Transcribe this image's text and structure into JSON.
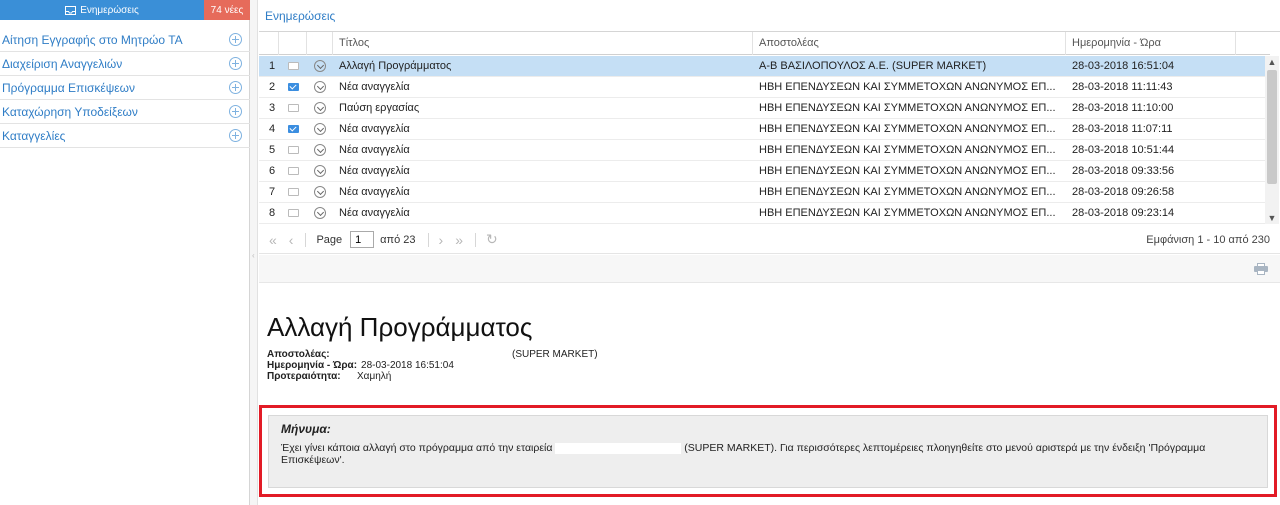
{
  "sidebar": {
    "title": "Ενημερώσεις",
    "badge": "74 νέες",
    "items": [
      {
        "label": "Αίτηση Εγγραφής στο Μητρώο ΤΑ"
      },
      {
        "label": "Διαχείριση Αναγγελιών"
      },
      {
        "label": "Πρόγραμμα Επισκέψεων"
      },
      {
        "label": "Καταχώρηση Υποδείξεων"
      },
      {
        "label": "Καταγγελίες"
      }
    ]
  },
  "panel": {
    "title": "Ενημερώσεις"
  },
  "grid": {
    "columns": {
      "title": "Τίτλος",
      "sender": "Αποστολέας",
      "date": "Ημερομηνία - Ώρα"
    },
    "rows": [
      {
        "num": "1",
        "read": true,
        "title": "Αλλαγή Προγράμματος",
        "sender": "Α-Β ΒΑΣΙΛΟΠΟΥΛΟΣ Α.Ε. (SUPER MARKET)",
        "date": "28-03-2018 16:51:04",
        "selected": true
      },
      {
        "num": "2",
        "read": false,
        "title": "Νέα αναγγελία",
        "sender": "ΗΒΗ ΕΠΕΝΔΥΣΕΩΝ ΚΑΙ ΣΥΜΜΕΤΟΧΩΝ ΑΝΩΝΥΜΟΣ ΕΠ...",
        "date": "28-03-2018 11:11:43",
        "selected": false
      },
      {
        "num": "3",
        "read": true,
        "title": "Παύση εργασίας",
        "sender": "ΗΒΗ ΕΠΕΝΔΥΣΕΩΝ ΚΑΙ ΣΥΜΜΕΤΟΧΩΝ ΑΝΩΝΥΜΟΣ ΕΠ...",
        "date": "28-03-2018 11:10:00",
        "selected": false
      },
      {
        "num": "4",
        "read": false,
        "title": "Νέα αναγγελία",
        "sender": "ΗΒΗ ΕΠΕΝΔΥΣΕΩΝ ΚΑΙ ΣΥΜΜΕΤΟΧΩΝ ΑΝΩΝΥΜΟΣ ΕΠ...",
        "date": "28-03-2018 11:07:11",
        "selected": false
      },
      {
        "num": "5",
        "read": true,
        "title": "Νέα αναγγελία",
        "sender": "ΗΒΗ ΕΠΕΝΔΥΣΕΩΝ ΚΑΙ ΣΥΜΜΕΤΟΧΩΝ ΑΝΩΝΥΜΟΣ ΕΠ...",
        "date": "28-03-2018 10:51:44",
        "selected": false
      },
      {
        "num": "6",
        "read": true,
        "title": "Νέα αναγγελία",
        "sender": "ΗΒΗ ΕΠΕΝΔΥΣΕΩΝ ΚΑΙ ΣΥΜΜΕΤΟΧΩΝ ΑΝΩΝΥΜΟΣ ΕΠ...",
        "date": "28-03-2018 09:33:56",
        "selected": false
      },
      {
        "num": "7",
        "read": true,
        "title": "Νέα αναγγελία",
        "sender": "ΗΒΗ ΕΠΕΝΔΥΣΕΩΝ ΚΑΙ ΣΥΜΜΕΤΟΧΩΝ ΑΝΩΝΥΜΟΣ ΕΠ...",
        "date": "28-03-2018 09:26:58",
        "selected": false
      },
      {
        "num": "8",
        "read": true,
        "title": "Νέα αναγγελία",
        "sender": "ΗΒΗ ΕΠΕΝΔΥΣΕΩΝ ΚΑΙ ΣΥΜΜΕΤΟΧΩΝ ΑΝΩΝΥΜΟΣ ΕΠ...",
        "date": "28-03-2018 09:23:14",
        "selected": false
      }
    ]
  },
  "pager": {
    "page_label": "Page",
    "page_value": "1",
    "of_label": "από 23",
    "info": "Εμφάνιση 1 - 10 από 230"
  },
  "detail": {
    "title": "Αλλαγή Προγράμματος",
    "sender_label": "Αποστολέας:",
    "sender_value": "(SUPER MARKET)",
    "date_label": "Ημερομηνία - Ώρα:",
    "date_value": "28-03-2018 16:51:04",
    "priority_label": "Προτεραιότητα:",
    "priority_value": "Χαμηλή",
    "message_label": "Μήνυμα:",
    "message_before": "Έχει γίνει κάποια αλλαγή στο πρόγραμμα από την εταιρεία",
    "message_after": "(SUPER MARKET). Για περισσότερες λεπτομέρειες πλοηγηθείτε στο μενού αριστερά με την ένδειξη 'Πρόγραμμα Επισκέψεων'."
  },
  "colors": {
    "accent": "#3a8fd7",
    "badge": "#e66b5b",
    "selected_row": "#c5dff5",
    "highlight_border": "#e21b26"
  }
}
